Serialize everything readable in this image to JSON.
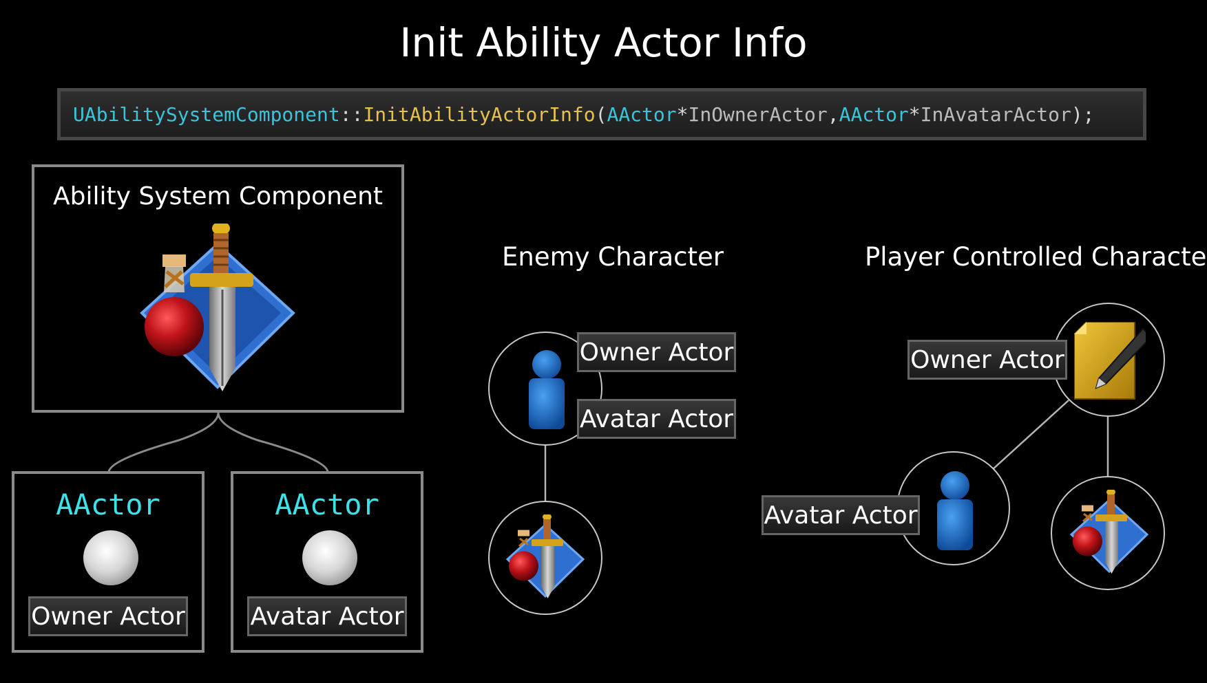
{
  "title": "Init Ability Actor Info",
  "code": {
    "class_name": "UAbilitySystemComponent",
    "scope": "::",
    "function_name": "InitAbilityActorInfo",
    "open_paren": "(",
    "param1_type": "AActor",
    "param1_star": "*",
    "param1_name": " InOwnerActor",
    "comma": ", ",
    "param2_type": "AActor",
    "param2_star": "*",
    "param2_name": " InAvatarActor",
    "close": ");"
  },
  "asc_box": {
    "title": "Ability System Component",
    "icon": "ability-system-icon"
  },
  "owner_box": {
    "type": "AActor",
    "label": "Owner Actor",
    "icon": "sphere-icon"
  },
  "avatar_box": {
    "type": "AActor",
    "label": "Avatar Actor",
    "icon": "sphere-icon"
  },
  "enemy": {
    "heading": "Enemy Character",
    "owner_label": "Owner Actor",
    "avatar_label": "Avatar Actor",
    "character_icon": "pawn-icon",
    "asc_icon": "ability-system-icon"
  },
  "player": {
    "heading": "Player Controlled Character",
    "owner_label": "Owner Actor",
    "avatar_label": "Avatar Actor",
    "owner_icon": "player-state-icon",
    "character_icon": "pawn-icon",
    "asc_icon": "ability-system-icon"
  },
  "colors": {
    "code_type": "#3cc3dc",
    "code_function": "#e8c14b",
    "actor_type": "#3ce2e8",
    "diamond_blue": "#2f6fd0",
    "potion_red": "#c0141a",
    "pawn_blue": "#1d6ac4",
    "state_gold": "#d2a419"
  }
}
